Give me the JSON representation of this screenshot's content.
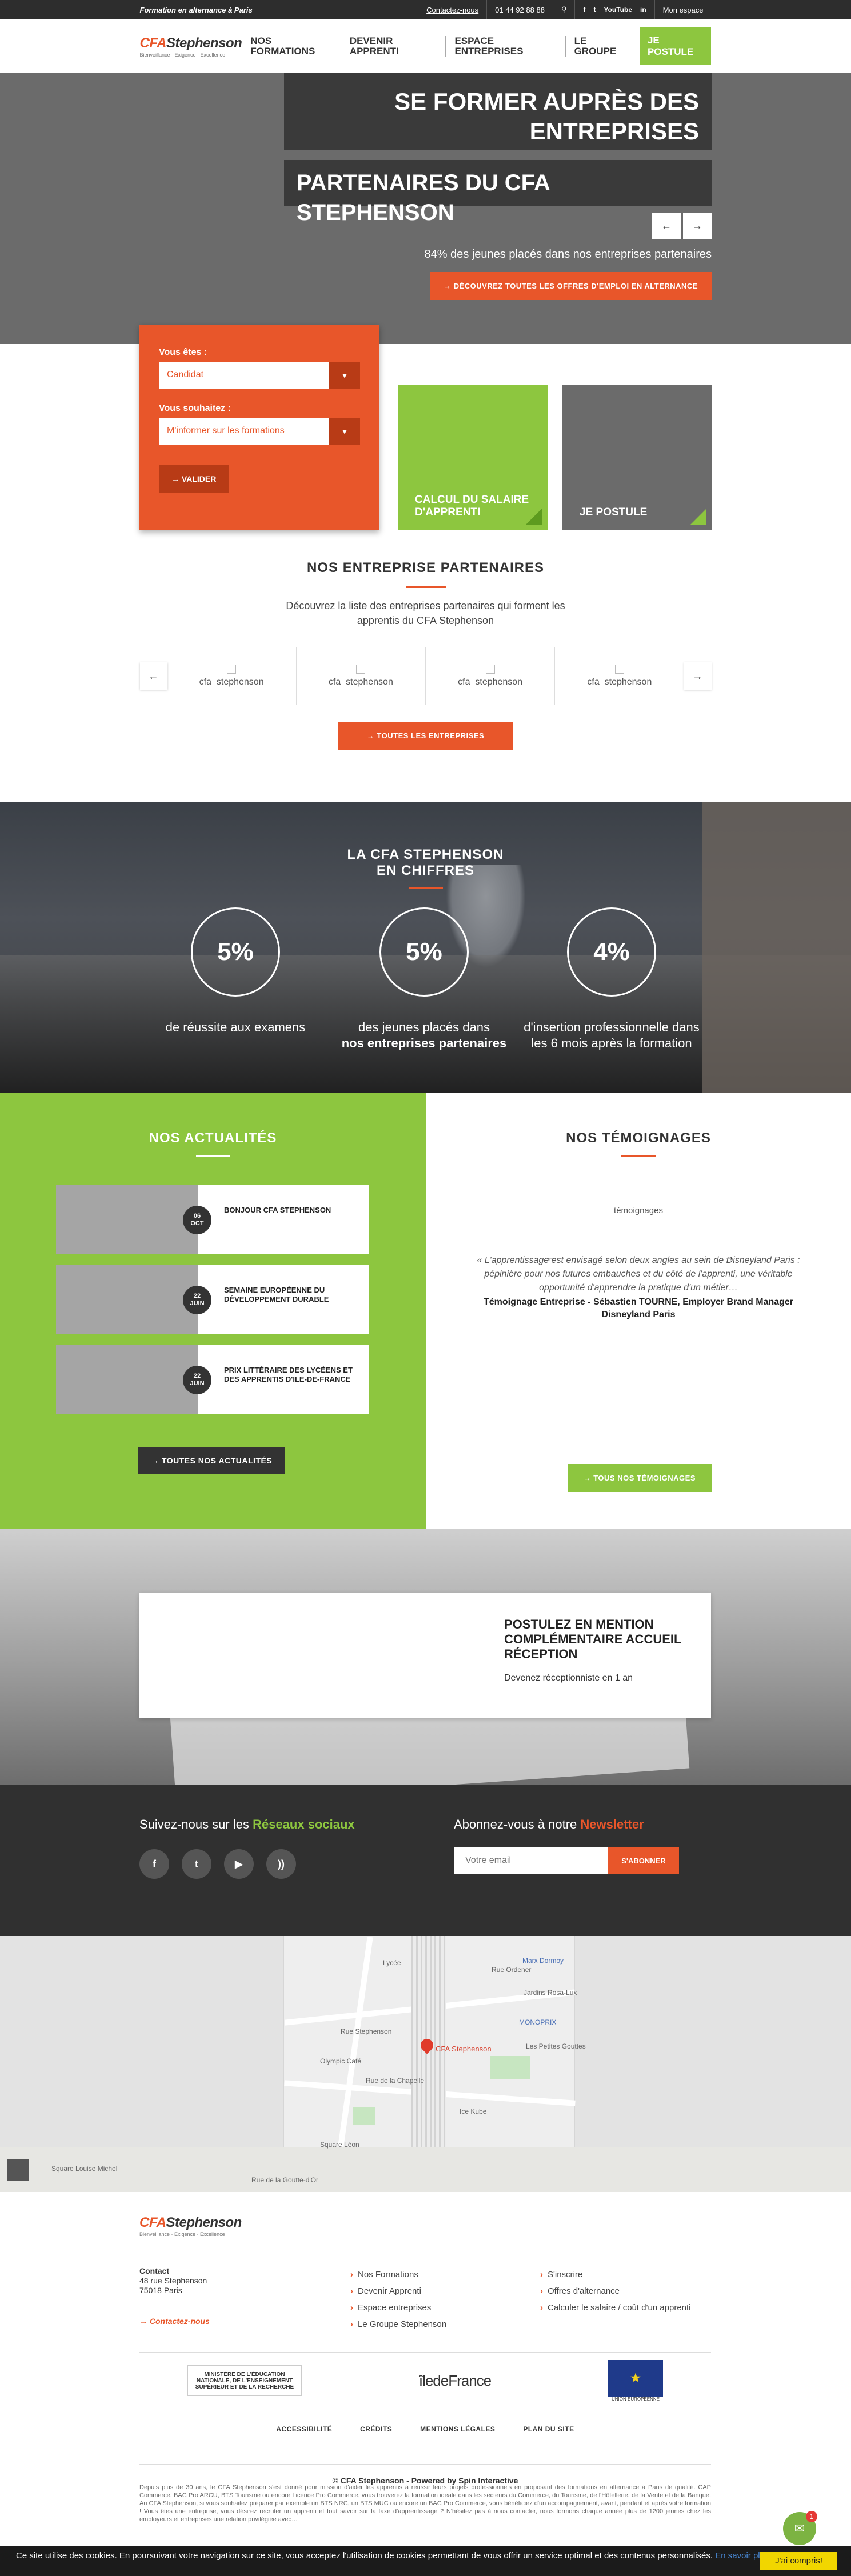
{
  "topbar": {
    "tagline": "Formation en alternance à Paris",
    "contact": "Contactez-nous",
    "phone": "01 44 92 88 88",
    "search_icon": "search-icon",
    "social": [
      "f",
      "t",
      "YouTube",
      "in"
    ],
    "account": "Mon espace"
  },
  "header": {
    "logo_main": "CFA",
    "logo_brand": "Stephenson",
    "logo_tag": "Bienveillance · Exigence · Excellence",
    "nav": [
      "NOS FORMATIONS",
      "DEVENIR APPRENTI",
      "ESPACE ENTREPRISES",
      "LE GROUPE"
    ],
    "apply": "JE POSTULE"
  },
  "hero": {
    "title1": "SE FORMER AUPRÈS DES ENTREPRISES",
    "title2": "PARTENAIRES DU CFA STEPHENSON",
    "prev": "←",
    "next": "→",
    "stat": "84% des jeunes placés dans nos entreprises partenaires",
    "cta": "→  DÉCOUVREZ TOUTES LES OFFRES D'EMPLOI EN ALTERNANCE"
  },
  "form": {
    "label1": "Vous êtes :",
    "value1": "Candidat",
    "label2": "Vous souhaitez :",
    "value2": "M'informer sur les formations",
    "submit": "→  VALIDER"
  },
  "tiles": {
    "salary": "CALCUL DU SALAIRE D'APPRENTI",
    "apply": "JE POSTULE"
  },
  "partners": {
    "title": "NOS ENTREPRISE PARTENAIRES",
    "desc": "Découvrez la liste des entreprises partenaires qui forment les apprentis du CFA Stephenson",
    "logos": [
      "cfa_stephenson",
      "cfa_stephenson",
      "cfa_stephenson",
      "cfa_stephenson"
    ],
    "prev": "←",
    "next": "→",
    "button": "→  TOUTES LES ENTREPRISES"
  },
  "stats": {
    "title1": "LA CFA STEPHENSON",
    "title2": "EN CHIFFRES",
    "items": [
      {
        "value": "5%",
        "label": "de réussite aux examens",
        "bold": ""
      },
      {
        "value": "5%",
        "label": "des jeunes placés dans",
        "bold": "nos entreprises partenaires"
      },
      {
        "value": "4%",
        "label": "d'insertion professionnelle dans les 6 mois après la formation",
        "bold": ""
      }
    ]
  },
  "news": {
    "title": "NOS ACTUALITÉS",
    "items": [
      {
        "day": "06",
        "month": "OCT",
        "title": "BONJOUR CFA STEPHENSON"
      },
      {
        "day": "22",
        "month": "JUIN",
        "title": "SEMAINE EUROPÉENNE DU DÉVELOPPEMENT DURABLE"
      },
      {
        "day": "22",
        "month": "JUIN",
        "title": "PRIX LITTÉRAIRE DES LYCÉENS ET DES APPRENTIS D'ILE-DE-FRANCE"
      }
    ],
    "button": "→  TOUTES NOS ACTUALITÉS"
  },
  "testimonials": {
    "title": "NOS TÉMOIGNAGES",
    "image_alt": "témoignages",
    "quote": "« L'apprentissage est envisagé selon deux angles au sein de Disneyland Paris : pépinière pour nos futures embauches et du côté de l'apprenti, une véritable opportunité d'apprendre la pratique d'un métier…",
    "author": "Témoignage Entreprise - Sébastien TOURNE, Employer Brand Manager Disneyland Paris",
    "prev": "←",
    "next": "→",
    "button": "→  TOUS NOS TÉMOIGNAGES"
  },
  "promo": {
    "title": "POSTULEZ EN MENTION COMPLÉMENTAIRE ACCUEIL RÉCEPTION",
    "subtitle": "Devenez réceptionniste en 1 an"
  },
  "social": {
    "follow_pre": "Suivez-nous sur les ",
    "follow_accent": "Réseaux sociaux",
    "icons": [
      "f",
      "t",
      "▶",
      "))"
    ],
    "newsletter_pre": "Abonnez-vous à notre ",
    "newsletter_accent": "Newsletter",
    "email_placeholder": "Votre email",
    "subscribe": "S'ABONNER"
  },
  "map": {
    "pin_label": "CFA Stephenson",
    "labels": [
      "Lycée",
      "Rue Ordener",
      "Marx Dormoy",
      "Jardins Rosa-Lux",
      "MONOPRIX",
      "Rue Stephenson",
      "Olympic Café",
      "Les Petites Gouttes",
      "Rue de la Chapelle",
      "Square Léon",
      "Ice Kube",
      "Square Louise Michel",
      "Rue de la Goutte-d'Or"
    ]
  },
  "footer": {
    "logo_main": "CFA",
    "logo_brand": "Stephenson",
    "logo_tag": "Bienveillance · Exigence · Excellence",
    "contact_title": "Contact",
    "address1": "48 rue Stephenson",
    "address2": "75018 Paris",
    "contact_link": "→ Contactez-nous",
    "col1": [
      "Nos Formations",
      "Devenir Apprenti",
      "Espace entreprises",
      "Le Groupe Stephenson"
    ],
    "col2": [
      "S'inscrire",
      "Offres d'alternance",
      "Calculer le salaire / coût d'un apprenti"
    ],
    "partner_logos": [
      "MINISTÈRE DE L'ÉDUCATION NATIONALE, DE L'ENSEIGNEMENT SUPÉRIEUR ET DE LA RECHERCHE",
      "îledeFrance",
      "★"
    ],
    "eu_caption": "UNION EUROPÉENNE",
    "links": [
      "ACCESSIBILITÉ",
      "CRÉDITS",
      "MENTIONS LÉGALES",
      "PLAN DU SITE"
    ],
    "copyright": "© CFA Stephenson - Powered by Spin Interactive",
    "small": "Depuis plus de 30 ans, le CFA Stephenson s'est donné pour mission d'aider les apprentis à réussir leurs projets professionnels en proposant des formations en alternance à Paris de qualité. CAP Commerce, BAC Pro ARCU, BTS Tourisme ou encore Licence Pro Commerce, vous trouverez la formation idéale dans les secteurs du Commerce, du Tourisme, de l'Hôtellerie, de la Vente et de la Banque. Au CFA Stephenson, si vous souhaitez préparer par exemple un BTS NRC, un BTS MUC ou encore un BAC Pro Commerce, vous bénéficiez d'un accompagnement, avant, pendant et après votre formation ! Vous êtes une entreprise, vous désirez recruter un apprenti et tout savoir sur la taxe d'apprentissage ? N'hésitez pas à nous contacter, nous formons chaque année plus de 1200 jeunes chez les employeurs et entreprises une relation privilégiée avec…"
  },
  "cookie": {
    "text": "Ce site utilise des cookies. En poursuivant votre navigation sur ce site, vous acceptez l'utilisation de cookies permettant de vous offrir un service optimal et des contenus personnalisés.",
    "link": "En savoir plus",
    "ok": "J'ai compris!",
    "chat_badge": "1"
  }
}
